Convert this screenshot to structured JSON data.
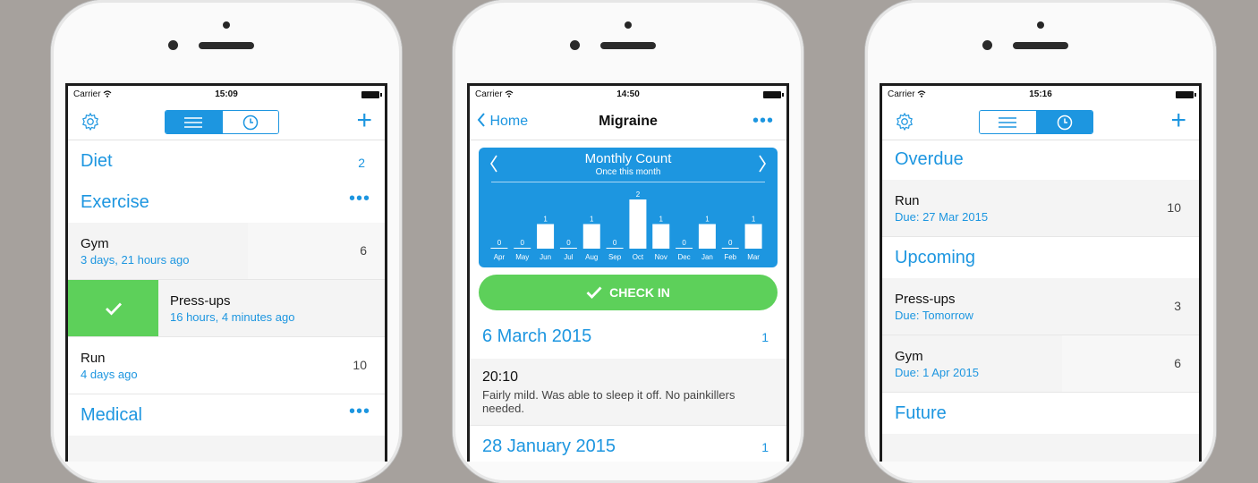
{
  "colors": {
    "accent": "#1d96e0",
    "green": "#5dd05a",
    "background": "#a6a19d"
  },
  "screen1": {
    "status": {
      "carrier": "Carrier",
      "time": "15:09"
    },
    "sections": {
      "diet": {
        "title": "Diet",
        "count": "2"
      },
      "exercise": {
        "title": "Exercise",
        "more": "•••"
      },
      "medical": {
        "title": "Medical",
        "more": "•••"
      }
    },
    "rows": {
      "gym": {
        "name": "Gym",
        "sub": "3 days, 21 hours ago",
        "num": "6"
      },
      "pressups": {
        "name": "Press-ups",
        "sub": "16 hours, 4 minutes ago"
      },
      "run": {
        "name": "Run",
        "sub": "4 days ago",
        "num": "10"
      }
    }
  },
  "screen2": {
    "status": {
      "carrier": "Carrier",
      "time": "14:50"
    },
    "nav": {
      "back": "Home",
      "title": "Migraine",
      "more": "•••"
    },
    "chart_data": {
      "type": "bar",
      "title": "Monthly Count",
      "subtitle": "Once this month",
      "categories": [
        "Apr",
        "May",
        "Jun",
        "Jul",
        "Aug",
        "Sep",
        "Oct",
        "Nov",
        "Dec",
        "Jan",
        "Feb",
        "Mar"
      ],
      "values": [
        0,
        0,
        1,
        0,
        1,
        0,
        2,
        1,
        0,
        1,
        0,
        1
      ],
      "ylim": [
        0,
        2
      ]
    },
    "checkin": "CHECK IN",
    "days": [
      {
        "date": "6 March 2015",
        "count": "1"
      },
      {
        "date": "28 January 2015",
        "count": "1"
      }
    ],
    "entry": {
      "time": "20:10",
      "note": "Fairly mild. Was able to sleep it off. No painkillers needed."
    }
  },
  "screen3": {
    "status": {
      "carrier": "Carrier",
      "time": "15:16"
    },
    "sections": {
      "overdue": "Overdue",
      "upcoming": "Upcoming",
      "future": "Future"
    },
    "rows": {
      "run": {
        "name": "Run",
        "sub": "Due: 27 Mar 2015",
        "num": "10"
      },
      "pressups": {
        "name": "Press-ups",
        "sub": "Due: Tomorrow",
        "num": "3"
      },
      "gym": {
        "name": "Gym",
        "sub": "Due: 1 Apr 2015",
        "num": "6"
      }
    }
  }
}
